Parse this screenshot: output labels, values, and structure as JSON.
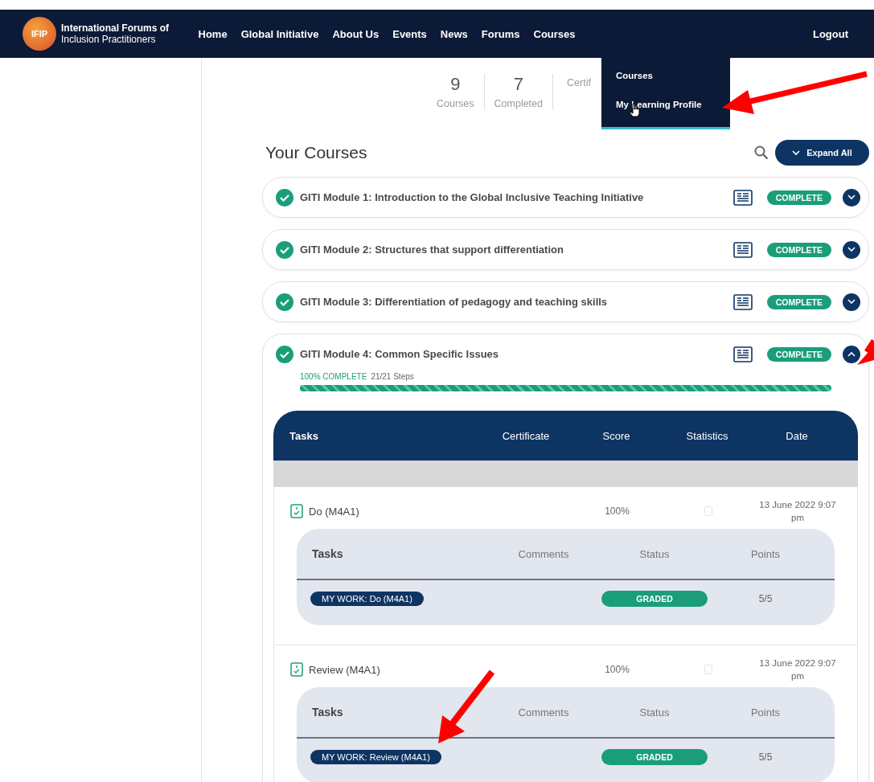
{
  "header": {
    "logo_mark": "IFIP",
    "logo_line1": "International Forums of",
    "logo_line2": "Inclusion Practitioners",
    "nav": [
      {
        "label": "Home"
      },
      {
        "label": "Global Initiative"
      },
      {
        "label": "About Us"
      },
      {
        "label": "Events"
      },
      {
        "label": "News"
      },
      {
        "label": "Forums"
      },
      {
        "label": "Courses"
      }
    ],
    "logout": "Logout",
    "dropdown": [
      {
        "label": "Courses",
        "hovered": false
      },
      {
        "label": "My Learning Profile",
        "hovered": true
      }
    ]
  },
  "stats": [
    {
      "value": "9",
      "label": "Courses"
    },
    {
      "value": "7",
      "label": "Completed"
    },
    {
      "label": "Certif"
    }
  ],
  "courses_title": "Your Courses",
  "expand_all": "Expand All",
  "courses": [
    {
      "title": "GITI Module 1: Introduction to the Global Inclusive Teaching Initiative",
      "badge": "COMPLETE",
      "expanded": false
    },
    {
      "title": "GITI Module 2: Structures that support differentiation",
      "badge": "COMPLETE",
      "expanded": false
    },
    {
      "title": "GITI Module 3: Differentiation of pedagogy and teaching skills",
      "badge": "COMPLETE",
      "expanded": false
    },
    {
      "title": "GITI Module 4: Common Specific Issues",
      "badge": "COMPLETE",
      "expanded": true,
      "progress": {
        "percent": "100% COMPLETE",
        "steps": "21/21 Steps",
        "level": 1
      },
      "table": {
        "columns": [
          "Tasks",
          "Certificate",
          "Score",
          "Statistics",
          "Date"
        ],
        "rows": [
          {
            "title": "Do (M4A1)",
            "score": "100%",
            "date": "13 June 2022 9:07 pm",
            "sub_columns": [
              "Tasks",
              "Comments",
              "Status",
              "Points"
            ],
            "sub_rows": [
              {
                "work": "MY WORK: Do (M4A1)",
                "status": "GRADED",
                "points": "5/5"
              }
            ]
          },
          {
            "title": "Review (M4A1)",
            "score": "100%",
            "date": "13 June 2022 9:07 pm",
            "sub_columns": [
              "Tasks",
              "Comments",
              "Status",
              "Points"
            ],
            "sub_rows": [
              {
                "work": "MY WORK: Review (M4A1)",
                "status": "GRADED",
                "points": "5/5"
              }
            ]
          }
        ]
      }
    }
  ]
}
